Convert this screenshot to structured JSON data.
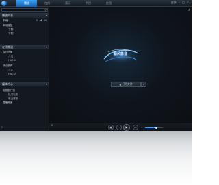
{
  "app": {
    "tabs": [
      {
        "label": "播放",
        "active": true
      },
      {
        "label": "在线",
        "active": false
      },
      {
        "label": "演示",
        "active": false
      },
      {
        "label": "节目",
        "active": false
      },
      {
        "label": "应用",
        "active": false
      }
    ],
    "window_controls": [
      "皮肤"
    ]
  },
  "sidebar": {
    "playlist_header": "播放列表",
    "playlist_tools": "⊡ ✚ ⊟",
    "local_label": "本地 ·",
    "local_items": [
      {
        "label": "本地播放",
        "sub": false
      },
      {
        "label": "下载1",
        "sub": true
      },
      {
        "label": "下载2",
        "sub": true
      }
    ],
    "online_header": "在线频道",
    "online_items": [
      {
        "label": "今日热播",
        "sub": false
      },
      {
        "label": "八达",
        "sub": true
      },
      {
        "label": "HACKS",
        "sub": true
      },
      {
        "label": "热点新闻",
        "sub": false
      },
      {
        "label": "八达",
        "sub": true
      },
      {
        "label": "HACKS",
        "sub": true
      }
    ],
    "media_header": "媒体中心",
    "media_items": [
      {
        "label": "电视剧门馆",
        "sub": false
      },
      {
        "label": "热门电影",
        "sub": true
      },
      {
        "label": "最近看剧",
        "sub": true
      },
      {
        "label": "直播频道",
        "sub": false
      }
    ],
    "footer": "⊡"
  },
  "main": {
    "brand_text": "暴风影音",
    "open_button": "▲  打开文件",
    "open_dropdown": "▾"
  },
  "controls": {
    "stop": "■",
    "prev": "⏮",
    "play": "▶",
    "next": "⏭",
    "volume_icon": "◂",
    "volume_level": 0.65,
    "grid": "⊞"
  },
  "colors": {
    "accent": "#3aa0f0",
    "window_bg": "#101317",
    "sidebar_bg": "#14191f"
  }
}
